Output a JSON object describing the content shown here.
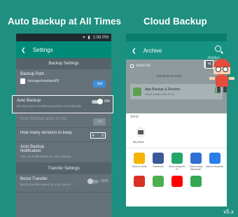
{
  "headings": {
    "left": "Auto Backup at All Times",
    "right": "Cloud Backup"
  },
  "version": "v5.x",
  "settings_phone": {
    "status_time": "1:06 PM",
    "toolbar_title": "Settings",
    "section_backup": "Backup Settings",
    "backup_path_label": "Backup Path :",
    "backup_path_value": "/storage/emulated/0/",
    "set_label": "Set",
    "auto_backup_title": "Auto Backup",
    "auto_backup_sub": "Backup every installation/update automatically",
    "auto_backup_state": "ON",
    "auto_backup_apps_title": "Auto Backup apps on list",
    "auto_backup_apps_set": "Set",
    "versions_title": "How many versions to keep",
    "versions_value": "5",
    "notif_title_1": "Auto Backup",
    "notif_title_2": "Notification",
    "notif_sub": "Turn on notifications for auto backup.",
    "section_transfer": "Transfer Settings",
    "boost_title": "Boost Transfer",
    "boost_sub": "Boost transfer speed for your device",
    "boost_state": "OFF"
  },
  "archive_phone": {
    "toolbar_title": "Archive",
    "hidden_tab": "Hidden",
    "select_all": "Select All",
    "pull_hint": "Pull down to scan",
    "app_name": "App Backup & Restore",
    "app_meta": "V5.6.6      4.9MB | 2021.07.12",
    "send_label": "Send",
    "drive_label": "My Drive",
    "share_targets": [
      {
        "label": "Save to Drive",
        "color": "#f4b400"
      },
      {
        "label": "Facebook",
        "color": "#3b5998"
      },
      {
        "label": "Send using Wi-Fi",
        "color": "#24a56b"
      },
      {
        "label": "Send using Bluetooth",
        "color": "#2f6fd6"
      },
      {
        "label": "Add to Dropbox",
        "color": "#2b7de9"
      },
      {
        "label": "",
        "color": "#d93025"
      },
      {
        "label": "",
        "color": "#4caf50"
      },
      {
        "label": "",
        "color": "#ff0000"
      },
      {
        "label": "",
        "color": "#34a853"
      }
    ]
  }
}
